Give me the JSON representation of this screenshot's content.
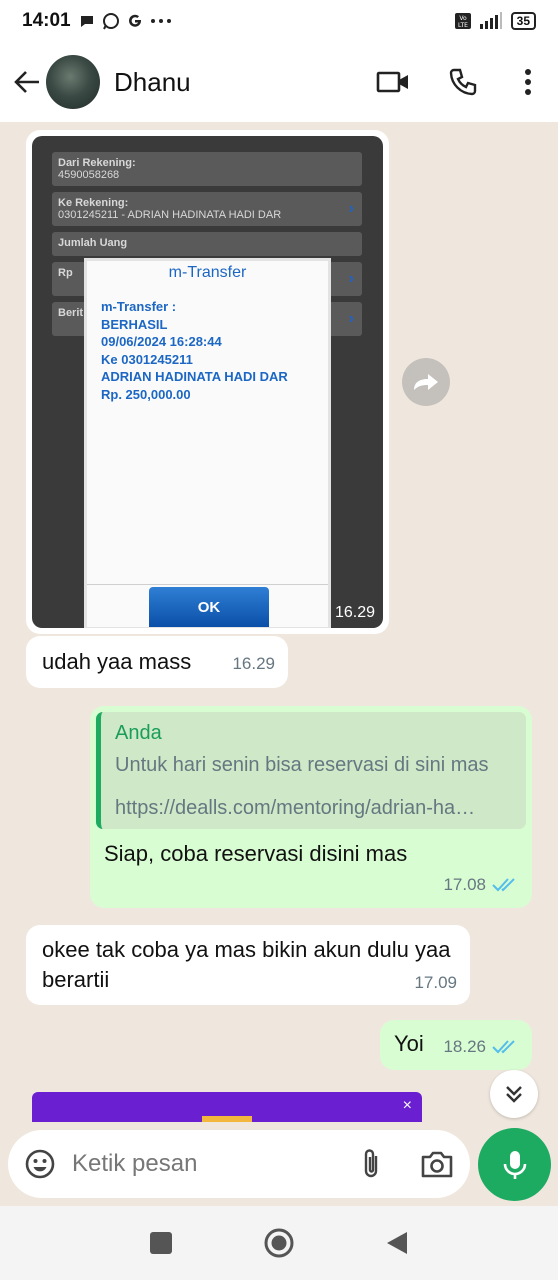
{
  "status_bar": {
    "time": "14:01",
    "battery": "35",
    "network_badge": "Vo LTE",
    "notif_icons": [
      "chat-bubble-icon",
      "whatsapp-icon",
      "google-icon",
      "more-dots-icon"
    ]
  },
  "header": {
    "contact_name": "Dhanu"
  },
  "transfer_image": {
    "form": {
      "from_label": "Dari Rekening:",
      "from_value": "4590058268",
      "to_label": "Ke Rekening:",
      "to_value": "0301245211 - ADRIAN HADINATA HADI DAR",
      "amount_label": "Jumlah Uang",
      "currency_label": "Rp",
      "note_label": "Berit"
    },
    "dialog": {
      "title": "m-Transfer",
      "lines": [
        "m-Transfer :",
        "BERHASIL",
        "09/06/2024 16:28:44",
        "Ke 0301245211",
        "ADRIAN HADINATA HADI DAR",
        "Rp. 250,000.00"
      ],
      "ok_label": "OK"
    },
    "time": "16.29"
  },
  "messages": [
    {
      "text": "udah yaa mass",
      "time": "16.29"
    },
    {
      "quote_author": "Anda",
      "quote_text": "Untuk hari senin bisa reservasi di sini mas",
      "quote_link": "https://dealls.com/mentoring/adrian-ha…",
      "text": "Siap, coba reservasi disini mas",
      "time": "17.08"
    },
    {
      "text": "okee tak coba ya mas bikin akun dulu yaa berartii",
      "time": "17.09"
    },
    {
      "text": "Yoi",
      "time": "18.26"
    }
  ],
  "banner": {
    "close": "×"
  },
  "composer": {
    "placeholder": "Ketik pesan"
  },
  "colors": {
    "accent_green": "#1daa61",
    "outgoing_bubble": "#d9fdd3",
    "chat_bg": "#efe7dd",
    "read_tick": "#53bdeb"
  }
}
